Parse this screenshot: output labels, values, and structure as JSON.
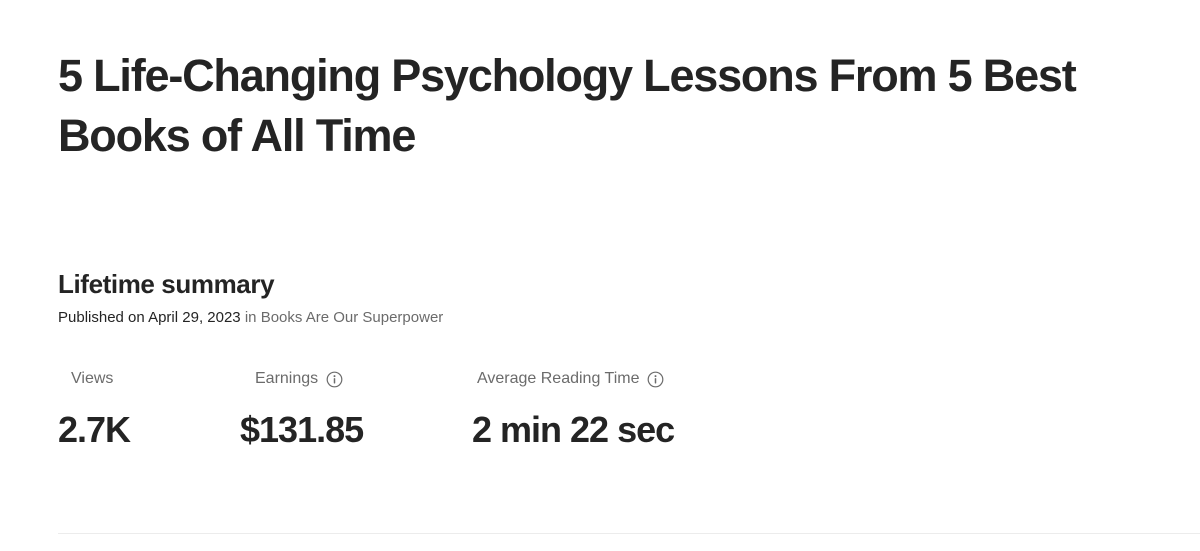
{
  "article": {
    "title": "5 Life-Changing Psychology Lessons From 5 Best Books of All Time"
  },
  "summary": {
    "heading": "Lifetime summary",
    "published_prefix": "Published on",
    "published_date": "April 29, 2023",
    "in_word": "in",
    "publication": "Books Are Our Superpower"
  },
  "stats": {
    "views": {
      "label": "Views",
      "value": "2.7K"
    },
    "earnings": {
      "label": "Earnings",
      "value": "$131.85",
      "icon": "info-icon"
    },
    "reading_time": {
      "label": "Average Reading Time",
      "value": "2 min 22 sec",
      "icon": "info-icon"
    }
  },
  "colors": {
    "text_primary": "#242424",
    "text_secondary": "#6b6b6b",
    "divider": "#ececec",
    "background": "#ffffff"
  }
}
